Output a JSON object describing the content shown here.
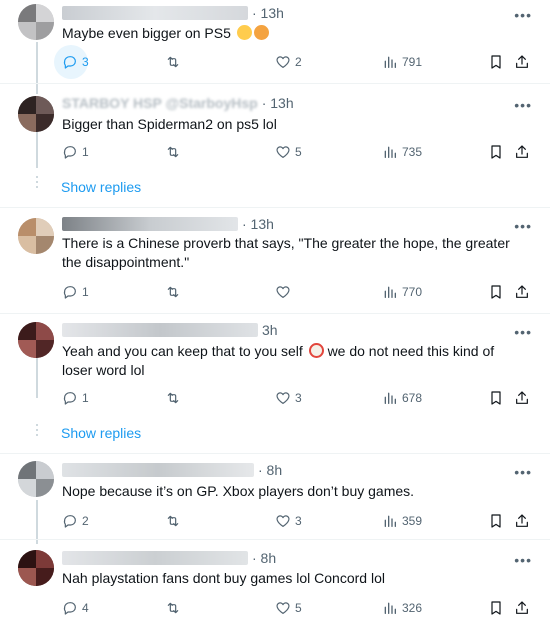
{
  "replies": [
    {
      "time": "· 13h",
      "text": "Maybe even bigger on PS5",
      "emojis": [
        "thinking-face-emoji",
        "face-with-hand-over-mouth-emoji"
      ],
      "reply_count": "3",
      "retweet_count": "",
      "like_count": "2",
      "view_count": "791",
      "reply_active": true
    },
    {
      "handle_fragment": "STARBOY HSP @StarboyHsp",
      "time": "· 13h",
      "text": "Bigger than Spiderman2 on ps5 lol",
      "reply_count": "1",
      "retweet_count": "",
      "like_count": "5",
      "view_count": "735"
    },
    {
      "time": "· 13h",
      "text": "There is a Chinese proverb that says, \"The greater the hope, the greater the disappointment.\"",
      "reply_count": "1",
      "retweet_count": "",
      "like_count": "",
      "view_count": "770"
    },
    {
      "time": "3h",
      "text_before": "Yeah and you can keep that to you self",
      "text_after": "we do not need this kind of loser word lol",
      "emojis": [
        "clown-face-emoji"
      ],
      "reply_count": "1",
      "retweet_count": "",
      "like_count": "3",
      "view_count": "678"
    },
    {
      "time": "· 8h",
      "text": "Nope because it’s on GP. Xbox players don’t buy games.",
      "reply_count": "2",
      "retweet_count": "",
      "like_count": "3",
      "view_count": "359"
    },
    {
      "time": "· 8h",
      "text": "Nah playstation fans dont buy games lol Concord lol",
      "reply_count": "4",
      "retweet_count": "",
      "like_count": "5",
      "view_count": "326"
    }
  ],
  "show_replies_label": "Show replies",
  "more_label": "•••",
  "colors": {
    "accent": "#1d9bf0",
    "secondary_text": "#536471",
    "divider": "#eff3f4"
  }
}
